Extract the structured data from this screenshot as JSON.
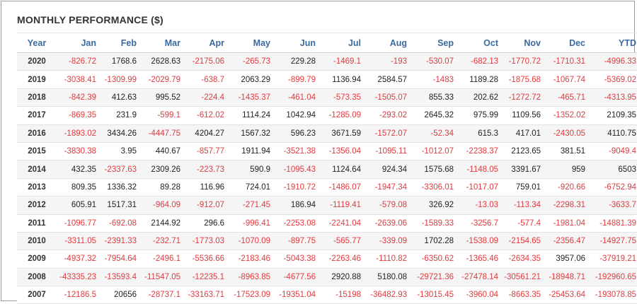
{
  "title": "MONTHLY PERFORMANCE ($)",
  "colors": {
    "negative": "#e03a3e",
    "positive": "#222222",
    "header": "#3a6aa0"
  },
  "columns": [
    "Year",
    "Jan",
    "Feb",
    "Mar",
    "Apr",
    "May",
    "Jun",
    "Jul",
    "Aug",
    "Sep",
    "Oct",
    "Nov",
    "Dec",
    "YTD"
  ],
  "rows": [
    [
      "2020",
      "-826.72",
      "1768.6",
      "2628.63",
      "-2175.06",
      "-265.73",
      "229.28",
      "-1469.1",
      "-193",
      "-530.07",
      "-682.13",
      "-1770.72",
      "-1710.31",
      "-4996.33"
    ],
    [
      "2019",
      "-3038.41",
      "-1309.99",
      "-2029.79",
      "-638.7",
      "2063.29",
      "-899.79",
      "1136.94",
      "2584.57",
      "-1483",
      "1189.28",
      "-1875.68",
      "-1067.74",
      "-5369.02"
    ],
    [
      "2018",
      "-842.39",
      "412.63",
      "995.52",
      "-224.4",
      "-1435.37",
      "-461.04",
      "-573.35",
      "-1505.07",
      "855.33",
      "202.62",
      "-1272.72",
      "-465.71",
      "-4313.95"
    ],
    [
      "2017",
      "-869.35",
      "231.9",
      "-599.1",
      "-612.02",
      "1114.24",
      "1042.94",
      "-1285.09",
      "-293.02",
      "2645.32",
      "975.99",
      "1109.56",
      "-1352.02",
      "2109.35"
    ],
    [
      "2016",
      "-1893.02",
      "3434.26",
      "-4447.75",
      "4204.27",
      "1567.32",
      "596.23",
      "3671.59",
      "-1572.07",
      "-52.34",
      "615.3",
      "417.01",
      "-2430.05",
      "4110.75"
    ],
    [
      "2015",
      "-3830.38",
      "3.95",
      "440.67",
      "-857.77",
      "1911.94",
      "-3521.38",
      "-1356.04",
      "-1095.11",
      "-1012.07",
      "-2238.37",
      "2123.65",
      "381.51",
      "-9049.4"
    ],
    [
      "2014",
      "432.35",
      "-2337.63",
      "2309.26",
      "-223.73",
      "590.9",
      "-1095.43",
      "1124.64",
      "924.34",
      "1575.68",
      "-1148.05",
      "3391.67",
      "959",
      "6503"
    ],
    [
      "2013",
      "809.35",
      "1336.32",
      "89.28",
      "116.96",
      "724.01",
      "-1910.72",
      "-1486.07",
      "-1947.34",
      "-3306.01",
      "-1017.07",
      "759.01",
      "-920.66",
      "-6752.94"
    ],
    [
      "2012",
      "605.91",
      "1517.31",
      "-964.09",
      "-912.07",
      "-271.45",
      "186.94",
      "-1119.41",
      "-579.08",
      "326.92",
      "-13.03",
      "-113.34",
      "-2298.31",
      "-3633.7"
    ],
    [
      "2011",
      "-1096.77",
      "-692.08",
      "2144.92",
      "296.6",
      "-996.41",
      "-2253.08",
      "-2241.04",
      "-2639.06",
      "-1589.33",
      "-3256.7",
      "-577.4",
      "-1981.04",
      "-14881.39"
    ],
    [
      "2010",
      "-3311.05",
      "-2391.33",
      "-232.71",
      "-1773.03",
      "-1070.09",
      "-897.75",
      "-565.77",
      "-339.09",
      "1702.28",
      "-1538.09",
      "-2154.65",
      "-2356.47",
      "-14927.75"
    ],
    [
      "2009",
      "-4937.32",
      "-7954.64",
      "-2496.1",
      "-5536.66",
      "-2183.46",
      "-5043.38",
      "-2263.46",
      "-1110.82",
      "-6350.62",
      "-1365.46",
      "-2634.35",
      "3957.06",
      "-37919.21"
    ],
    [
      "2008",
      "-43335.23",
      "-13593.4",
      "-11547.05",
      "-12235.1",
      "-8963.85",
      "-4677.56",
      "2920.88",
      "5180.08",
      "-29721.36",
      "-27478.14",
      "-30561.21",
      "-18948.71",
      "-192960.65"
    ],
    [
      "2007",
      "-12186.5",
      "20656",
      "-28737.1",
      "-33163.71",
      "-17523.09",
      "-19351.04",
      "-15198",
      "-36482.93",
      "-13015.45",
      "-3960.04",
      "-8663.35",
      "-25453.64",
      "-193078.85"
    ]
  ]
}
